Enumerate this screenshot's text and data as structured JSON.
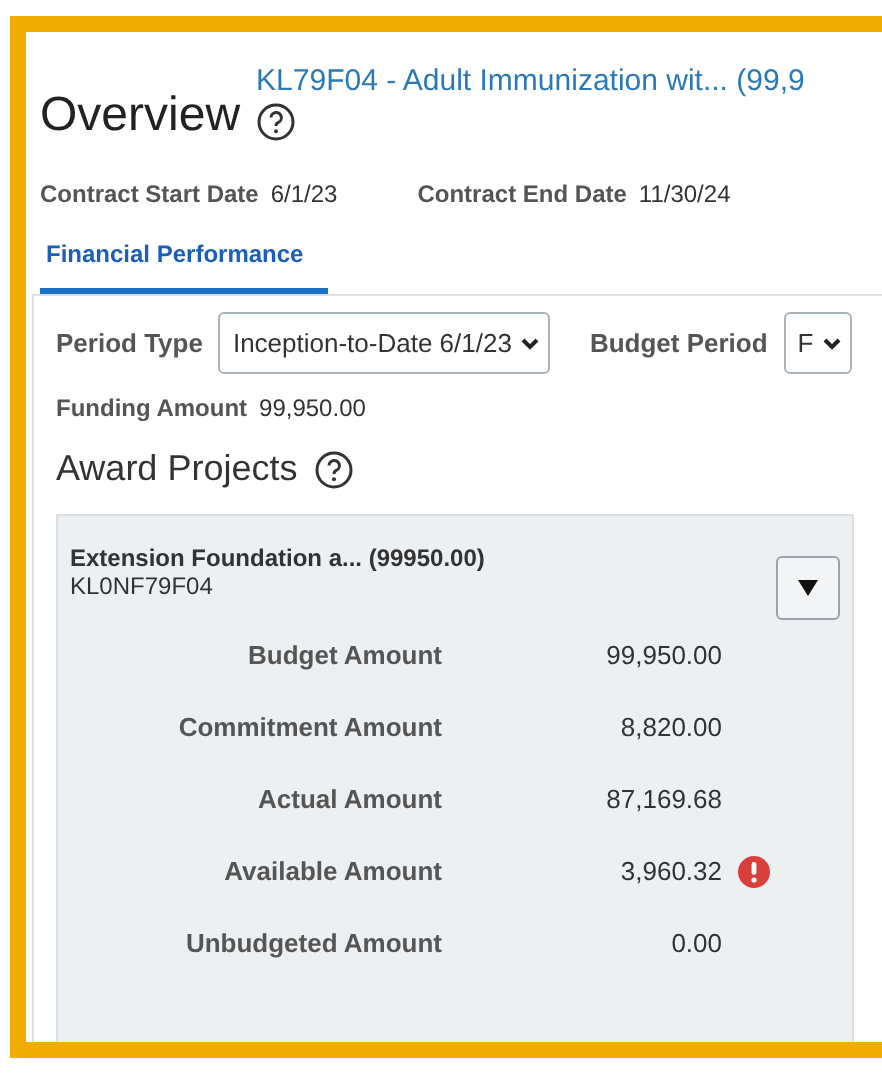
{
  "header": {
    "title": "Overview",
    "subtitle": "KL79F04 - Adult Immunization wit... (99,9"
  },
  "contract": [
    {
      "label": "Contract Start Date",
      "value": "6/1/23"
    },
    {
      "label": "Contract End Date",
      "value": "11/30/24"
    }
  ],
  "tabs": [
    {
      "label": "Financial Performance",
      "selected": true
    }
  ],
  "filters": [
    {
      "label": "Period Type",
      "value": "Inception-to-Date 6/1/23"
    },
    {
      "label": "Budget Period",
      "value": "F"
    }
  ],
  "funding": {
    "label": "Funding Amount",
    "value": "99,950.00"
  },
  "section_title": "Award Projects",
  "project": {
    "name": "Extension Foundation a... (99950.00)",
    "code": "KL0NF79F04",
    "rows": [
      {
        "label": "Budget Amount",
        "value": "99,950.00",
        "alert": false
      },
      {
        "label": "Commitment Amount",
        "value": "8,820.00",
        "alert": false
      },
      {
        "label": "Actual Amount",
        "value": "87,169.68",
        "alert": false
      },
      {
        "label": "Available Amount",
        "value": "3,960.32",
        "alert": true
      },
      {
        "label": "Unbudgeted Amount",
        "value": "0.00",
        "alert": false
      }
    ]
  }
}
